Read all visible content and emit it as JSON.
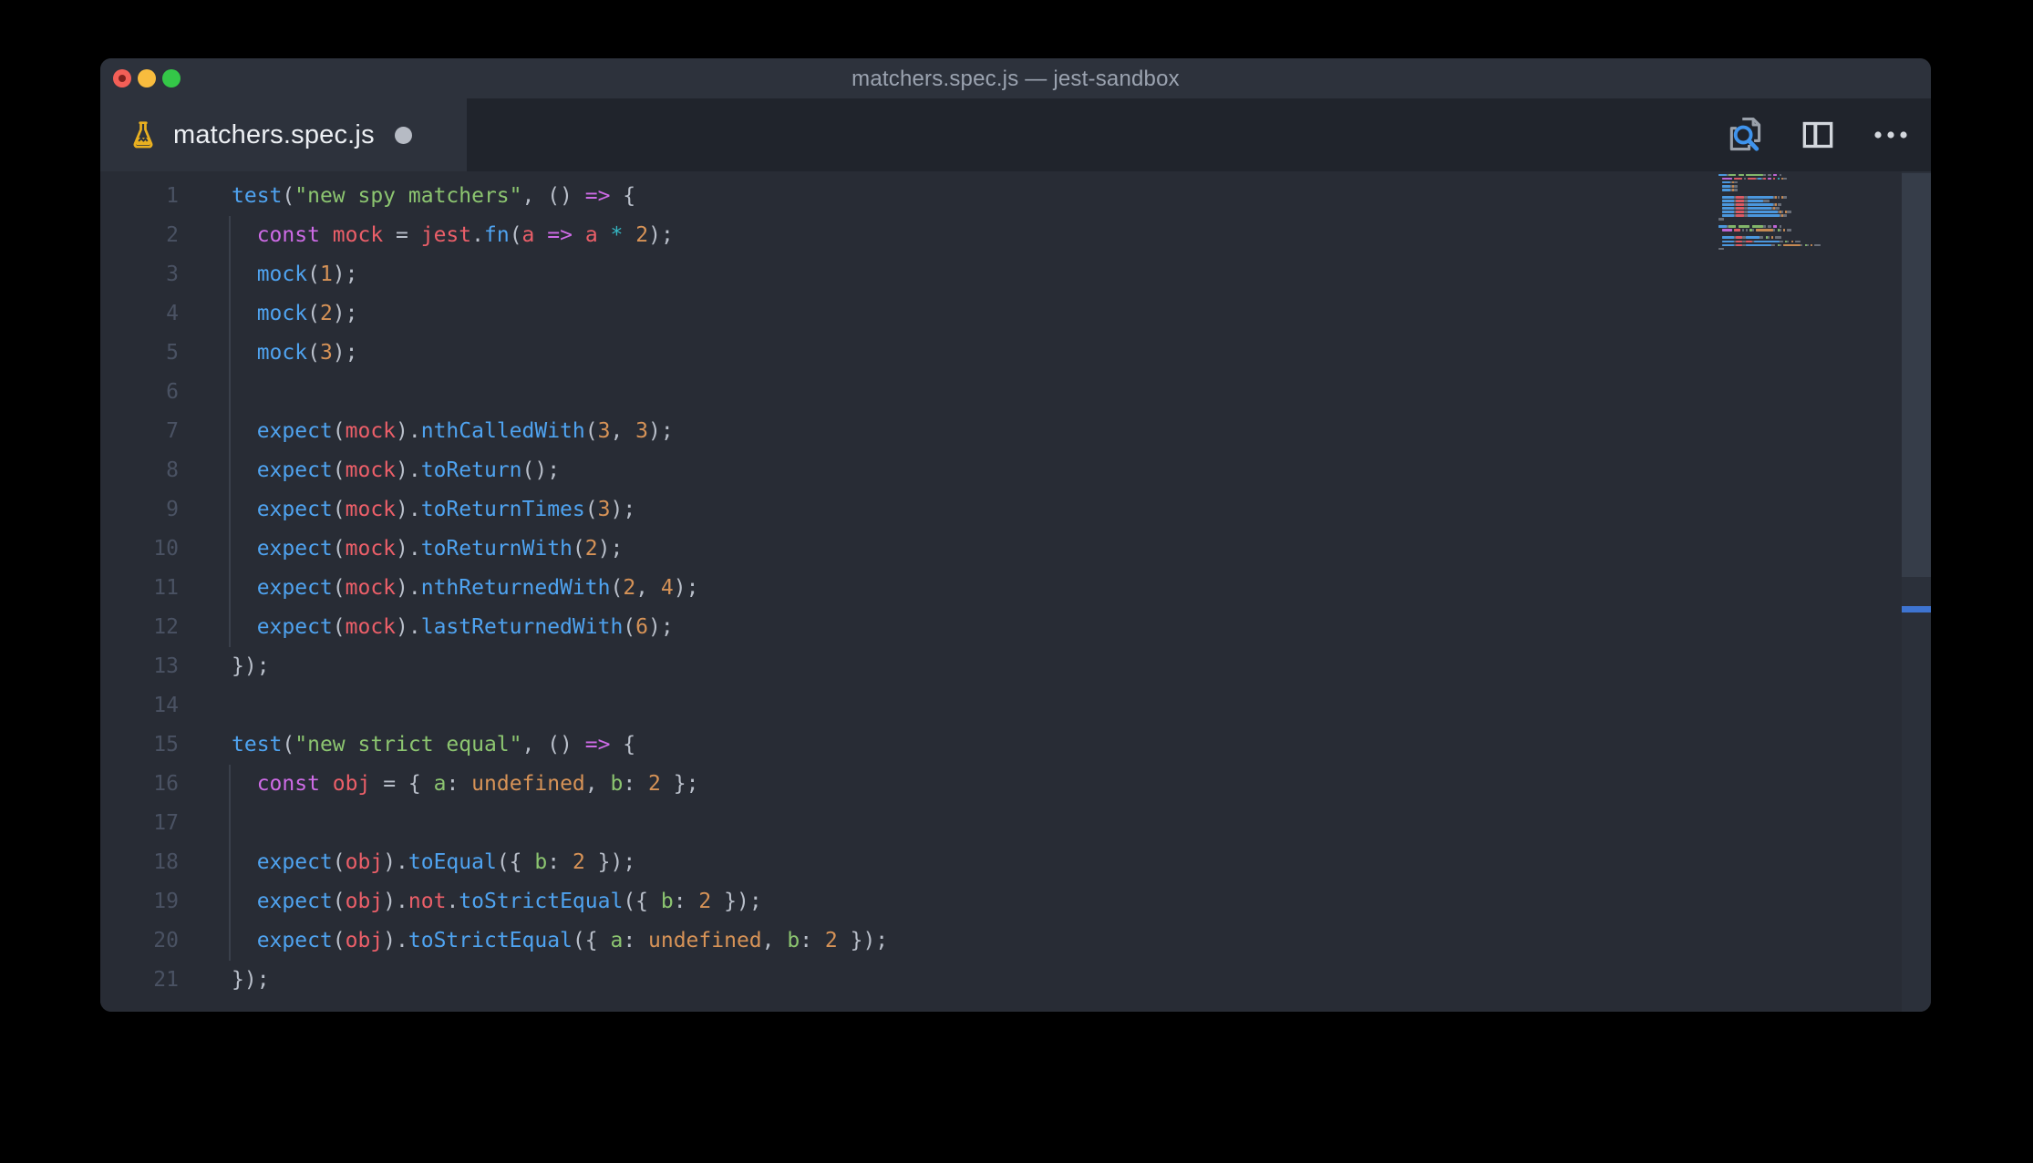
{
  "window": {
    "title": "matchers.spec.js — jest-sandbox",
    "traffic_lights": [
      "close",
      "minimize",
      "zoom"
    ],
    "close_has_unsaved_dot": true
  },
  "tab": {
    "label": "matchers.spec.js",
    "icon": "flask-test-icon",
    "modified": true
  },
  "editor_actions": [
    {
      "name": "search-editor",
      "icon": "file-search-icon"
    },
    {
      "name": "split-editor",
      "icon": "split-editor-icon"
    },
    {
      "name": "more-actions",
      "icon": "ellipsis-icon"
    }
  ],
  "colors": {
    "fn": "#4FA3F0",
    "v": "#EC5F69",
    "kw": "#CE6BE6",
    "s": "#8CC570",
    "n": "#D79357",
    "cy": "#35B8C4",
    "p": "#B9BFCA",
    "lineNumber": "#4A5263",
    "guide": "#3A404B",
    "editorBg": "#282C35",
    "chromeBg": "#2D323C",
    "tabstripBg": "#20242C",
    "close": "#F35F57",
    "minimize": "#F8BC3E",
    "zoom": "#34C748",
    "marker": "#3E74D1",
    "flask": "#E9B020",
    "iconGray": "#9AA1AB",
    "iconBright": "#D3D7DD",
    "accentBlue": "#3F94EE"
  },
  "minimap": {
    "visible": true
  },
  "scrollbar": {
    "thumb_visible": true,
    "marker_visible": true
  },
  "code": {
    "language": "javascript",
    "lines": [
      {
        "n": 1,
        "i": 0,
        "g": false,
        "t": [
          [
            "fn",
            "test"
          ],
          [
            "p",
            "("
          ],
          [
            "s",
            "\"new spy matchers\""
          ],
          [
            "p",
            ", () "
          ],
          [
            "kw",
            "=>"
          ],
          [
            "p",
            " {"
          ]
        ]
      },
      {
        "n": 2,
        "i": 2,
        "g": true,
        "t": [
          [
            "kw",
            "const"
          ],
          [
            "p",
            " "
          ],
          [
            "v",
            "mock"
          ],
          [
            "p",
            " = "
          ],
          [
            "v",
            "jest"
          ],
          [
            "p",
            "."
          ],
          [
            "fn",
            "fn"
          ],
          [
            "p",
            "("
          ],
          [
            "v",
            "a"
          ],
          [
            "p",
            " "
          ],
          [
            "kw",
            "=>"
          ],
          [
            "p",
            " "
          ],
          [
            "v",
            "a"
          ],
          [
            "p",
            " "
          ],
          [
            "cy",
            "*"
          ],
          [
            "p",
            " "
          ],
          [
            "n",
            "2"
          ],
          [
            "p",
            ");"
          ]
        ]
      },
      {
        "n": 3,
        "i": 2,
        "g": true,
        "t": [
          [
            "fn",
            "mock"
          ],
          [
            "p",
            "("
          ],
          [
            "n",
            "1"
          ],
          [
            "p",
            ");"
          ]
        ]
      },
      {
        "n": 4,
        "i": 2,
        "g": true,
        "t": [
          [
            "fn",
            "mock"
          ],
          [
            "p",
            "("
          ],
          [
            "n",
            "2"
          ],
          [
            "p",
            ");"
          ]
        ]
      },
      {
        "n": 5,
        "i": 2,
        "g": true,
        "t": [
          [
            "fn",
            "mock"
          ],
          [
            "p",
            "("
          ],
          [
            "n",
            "3"
          ],
          [
            "p",
            ");"
          ]
        ]
      },
      {
        "n": 6,
        "i": 2,
        "g": true,
        "t": []
      },
      {
        "n": 7,
        "i": 2,
        "g": true,
        "t": [
          [
            "fn",
            "expect"
          ],
          [
            "p",
            "("
          ],
          [
            "v",
            "mock"
          ],
          [
            "p",
            ")."
          ],
          [
            "fn",
            "nthCalledWith"
          ],
          [
            "p",
            "("
          ],
          [
            "n",
            "3"
          ],
          [
            "p",
            ", "
          ],
          [
            "n",
            "3"
          ],
          [
            "p",
            ");"
          ]
        ]
      },
      {
        "n": 8,
        "i": 2,
        "g": true,
        "t": [
          [
            "fn",
            "expect"
          ],
          [
            "p",
            "("
          ],
          [
            "v",
            "mock"
          ],
          [
            "p",
            ")."
          ],
          [
            "fn",
            "toReturn"
          ],
          [
            "p",
            "();"
          ]
        ]
      },
      {
        "n": 9,
        "i": 2,
        "g": true,
        "t": [
          [
            "fn",
            "expect"
          ],
          [
            "p",
            "("
          ],
          [
            "v",
            "mock"
          ],
          [
            "p",
            ")."
          ],
          [
            "fn",
            "toReturnTimes"
          ],
          [
            "p",
            "("
          ],
          [
            "n",
            "3"
          ],
          [
            "p",
            ");"
          ]
        ]
      },
      {
        "n": 10,
        "i": 2,
        "g": true,
        "t": [
          [
            "fn",
            "expect"
          ],
          [
            "p",
            "("
          ],
          [
            "v",
            "mock"
          ],
          [
            "p",
            ")."
          ],
          [
            "fn",
            "toReturnWith"
          ],
          [
            "p",
            "("
          ],
          [
            "n",
            "2"
          ],
          [
            "p",
            ");"
          ]
        ]
      },
      {
        "n": 11,
        "i": 2,
        "g": true,
        "t": [
          [
            "fn",
            "expect"
          ],
          [
            "p",
            "("
          ],
          [
            "v",
            "mock"
          ],
          [
            "p",
            ")."
          ],
          [
            "fn",
            "nthReturnedWith"
          ],
          [
            "p",
            "("
          ],
          [
            "n",
            "2"
          ],
          [
            "p",
            ", "
          ],
          [
            "n",
            "4"
          ],
          [
            "p",
            ");"
          ]
        ]
      },
      {
        "n": 12,
        "i": 2,
        "g": true,
        "t": [
          [
            "fn",
            "expect"
          ],
          [
            "p",
            "("
          ],
          [
            "v",
            "mock"
          ],
          [
            "p",
            ")."
          ],
          [
            "fn",
            "lastReturnedWith"
          ],
          [
            "p",
            "("
          ],
          [
            "n",
            "6"
          ],
          [
            "p",
            ");"
          ]
        ]
      },
      {
        "n": 13,
        "i": 0,
        "g": false,
        "t": [
          [
            "p",
            "});"
          ]
        ]
      },
      {
        "n": 14,
        "i": 0,
        "g": false,
        "t": []
      },
      {
        "n": 15,
        "i": 0,
        "g": false,
        "t": [
          [
            "fn",
            "test"
          ],
          [
            "p",
            "("
          ],
          [
            "s",
            "\"new strict equal\""
          ],
          [
            "p",
            ", () "
          ],
          [
            "kw",
            "=>"
          ],
          [
            "p",
            " {"
          ]
        ]
      },
      {
        "n": 16,
        "i": 2,
        "g": true,
        "t": [
          [
            "kw",
            "const"
          ],
          [
            "p",
            " "
          ],
          [
            "v",
            "obj"
          ],
          [
            "p",
            " = { "
          ],
          [
            "s",
            "a"
          ],
          [
            "p",
            ": "
          ],
          [
            "n",
            "undefined"
          ],
          [
            "p",
            ", "
          ],
          [
            "s",
            "b"
          ],
          [
            "p",
            ": "
          ],
          [
            "n",
            "2"
          ],
          [
            "p",
            " };"
          ]
        ]
      },
      {
        "n": 17,
        "i": 2,
        "g": true,
        "t": []
      },
      {
        "n": 18,
        "i": 2,
        "g": true,
        "t": [
          [
            "fn",
            "expect"
          ],
          [
            "p",
            "("
          ],
          [
            "v",
            "obj"
          ],
          [
            "p",
            ")."
          ],
          [
            "fn",
            "toEqual"
          ],
          [
            "p",
            "({ "
          ],
          [
            "s",
            "b"
          ],
          [
            "p",
            ": "
          ],
          [
            "n",
            "2"
          ],
          [
            "p",
            " });"
          ]
        ]
      },
      {
        "n": 19,
        "i": 2,
        "g": true,
        "t": [
          [
            "fn",
            "expect"
          ],
          [
            "p",
            "("
          ],
          [
            "v",
            "obj"
          ],
          [
            "p",
            ")."
          ],
          [
            "v",
            "not"
          ],
          [
            "p",
            "."
          ],
          [
            "fn",
            "toStrictEqual"
          ],
          [
            "p",
            "({ "
          ],
          [
            "s",
            "b"
          ],
          [
            "p",
            ": "
          ],
          [
            "n",
            "2"
          ],
          [
            "p",
            " });"
          ]
        ]
      },
      {
        "n": 20,
        "i": 2,
        "g": true,
        "t": [
          [
            "fn",
            "expect"
          ],
          [
            "p",
            "("
          ],
          [
            "v",
            "obj"
          ],
          [
            "p",
            ")."
          ],
          [
            "fn",
            "toStrictEqual"
          ],
          [
            "p",
            "({ "
          ],
          [
            "s",
            "a"
          ],
          [
            "p",
            ": "
          ],
          [
            "n",
            "undefined"
          ],
          [
            "p",
            ", "
          ],
          [
            "s",
            "b"
          ],
          [
            "p",
            ": "
          ],
          [
            "n",
            "2"
          ],
          [
            "p",
            " });"
          ]
        ]
      },
      {
        "n": 21,
        "i": 0,
        "g": false,
        "t": [
          [
            "p",
            "});"
          ]
        ]
      }
    ]
  }
}
